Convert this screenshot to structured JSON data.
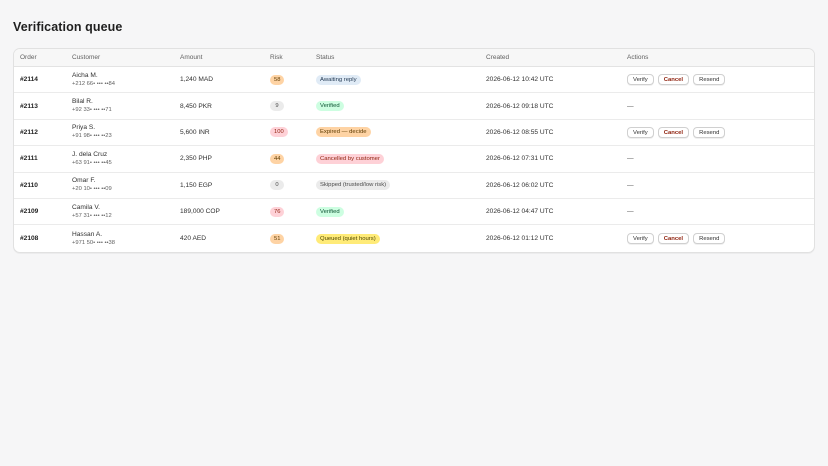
{
  "page": {
    "title": "Verification queue"
  },
  "table": {
    "headers": {
      "order": "Order",
      "customer": "Customer",
      "amount": "Amount",
      "risk": "Risk",
      "status": "Status",
      "created": "Created",
      "actions": "Actions"
    },
    "actions": {
      "verify": "Verify",
      "cancel": "Cancel",
      "resend": "Resend",
      "none": "—"
    },
    "rows": [
      {
        "order": "#2114",
        "name": "Aicha M.",
        "phone": "+212 66• ••• ••84",
        "amount": "1,240 MAD",
        "risk": "58",
        "risk_level": "mid",
        "status": "Awaiting reply",
        "status_tone": "info",
        "created": "2026-06-12 10:42 UTC",
        "actionable": true
      },
      {
        "order": "#2113",
        "name": "Bilal R.",
        "phone": "+92 33• ••• ••71",
        "amount": "8,450 PKR",
        "risk": "9",
        "risk_level": "low",
        "status": "Verified",
        "status_tone": "success",
        "created": "2026-06-12 09:18 UTC",
        "actionable": false
      },
      {
        "order": "#2112",
        "name": "Priya S.",
        "phone": "+91 98• ••• ••23",
        "amount": "5,600 INR",
        "risk": "100",
        "risk_level": "high",
        "status": "Expired — decide",
        "status_tone": "warning",
        "created": "2026-06-12 08:55 UTC",
        "actionable": true
      },
      {
        "order": "#2111",
        "name": "J. dela Cruz",
        "phone": "+63 91• ••• ••45",
        "amount": "2,350 PHP",
        "risk": "44",
        "risk_level": "mid",
        "status": "Cancelled by customer",
        "status_tone": "critical",
        "created": "2026-06-12 07:31 UTC",
        "actionable": false
      },
      {
        "order": "#2110",
        "name": "Omar F.",
        "phone": "+20 10• ••• ••09",
        "amount": "1,150 EGP",
        "risk": "0",
        "risk_level": "low",
        "status": "Skipped (trusted/low risk)",
        "status_tone": "neutral",
        "created": "2026-06-12 06:02 UTC",
        "actionable": false
      },
      {
        "order": "#2109",
        "name": "Camila V.",
        "phone": "+57 31• ••• ••12",
        "amount": "189,000 COP",
        "risk": "76",
        "risk_level": "high",
        "status": "Verified",
        "status_tone": "success",
        "created": "2026-06-12 04:47 UTC",
        "actionable": false
      },
      {
        "order": "#2108",
        "name": "Hassan A.",
        "phone": "+971 50• ••• ••38",
        "amount": "420 AED",
        "risk": "51",
        "risk_level": "mid",
        "status": "Queued (quiet hours)",
        "status_tone": "attention",
        "created": "2026-06-12 01:12 UTC",
        "actionable": true
      }
    ]
  }
}
